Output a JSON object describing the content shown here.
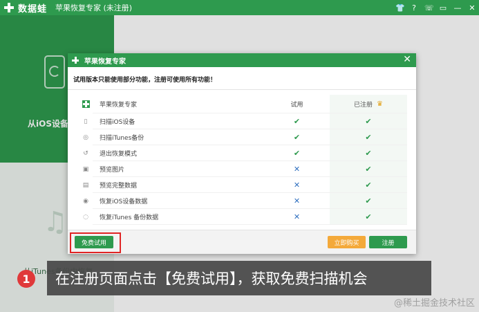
{
  "titlebar": {
    "logo_text": "数据蛙",
    "app_title": "苹果恢复专家 (未注册)",
    "buttons": [
      "👕",
      "?",
      "☏",
      "▭",
      "—",
      "✕"
    ]
  },
  "background": {
    "ios_label": "从iOS设备中",
    "itunes_label": "从iTunes备份中恢复"
  },
  "dialog": {
    "title": "苹果恢复专家",
    "notice": "试用版本只能使用部分功能，注册可使用所有功能！",
    "table": {
      "header": {
        "name": "苹果恢复专家",
        "trial": "试用",
        "registered": "已注册"
      },
      "rows": [
        {
          "icon": "▯",
          "name": "扫描iOS设备",
          "trial": "✔",
          "registered": "✔"
        },
        {
          "icon": "◎",
          "name": "扫描iTunes备份",
          "trial": "✔",
          "registered": "✔"
        },
        {
          "icon": "↺",
          "name": "退出恢复模式",
          "trial": "✔",
          "registered": "✔"
        },
        {
          "icon": "▣",
          "name": "预览图片",
          "trial": "✕",
          "registered": "✔"
        },
        {
          "icon": "▤",
          "name": "预览完整数据",
          "trial": "✕",
          "registered": "✔"
        },
        {
          "icon": "◉",
          "name": "恢复iOS设备数据",
          "trial": "✕",
          "registered": "✔"
        },
        {
          "icon": "◌",
          "name": "恢复iTunes 备份数据",
          "trial": "✕",
          "registered": "✔"
        }
      ]
    },
    "footer": {
      "free_trial": "免费试用",
      "buy_now": "立即购买",
      "register": "注册"
    },
    "close": "✕"
  },
  "caption": {
    "step": "1",
    "text": "在注册页面点击【免费试用】，获取免费扫描机会"
  },
  "watermark": "@稀土掘金技术社区",
  "colors": {
    "brand_green": "#2e9a4e",
    "buy_orange": "#f4a93a",
    "cross_blue": "#2f6fbf",
    "highlight_red": "#e02424"
  }
}
